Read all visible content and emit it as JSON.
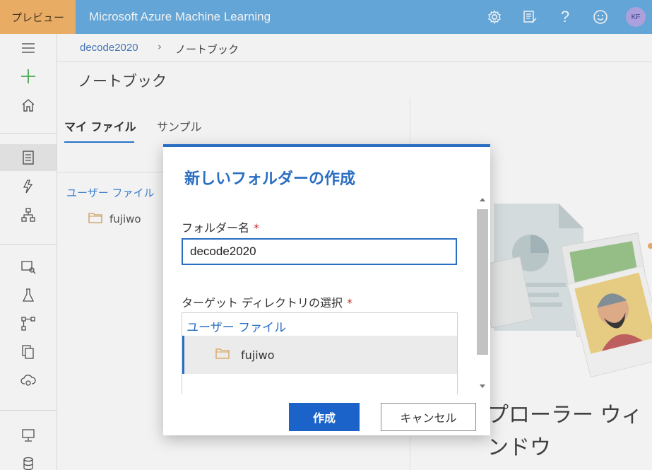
{
  "topbar": {
    "preview_label": "プレビュー",
    "app_title": "Microsoft Azure Machine Learning",
    "icons": [
      "settings-icon",
      "feedback-icon",
      "help-icon",
      "smiley-icon"
    ],
    "avatar_initials": "KF",
    "color": "#6aaee3",
    "preview_color": "#f5b66a"
  },
  "breadcrumb": {
    "workspace": "decode2020",
    "current": "ノートブック"
  },
  "page": {
    "title": "ノートブック"
  },
  "left_panel": {
    "tabs": [
      {
        "label": "マイ ファイル",
        "active": true
      },
      {
        "label": "サンプル",
        "active": false
      }
    ],
    "tree_header": "ユーザー ファイル",
    "items": [
      {
        "label": "fujiwo"
      }
    ]
  },
  "background_text": "プローラー ウィンドウ",
  "dialog": {
    "title": "新しいフォルダーの作成",
    "folder_name_label": "フォルダー名",
    "folder_name_value": "decode2020",
    "target_dir_label": "ターゲット ディレクトリの選択",
    "required_mark": "*",
    "dir_header": "ユーザー ファイル",
    "dir_items": [
      {
        "label": "fujiwo",
        "selected": true
      }
    ],
    "create_button": "作成",
    "cancel_button": "キャンセル",
    "accent_color": "#2a6ec3"
  }
}
